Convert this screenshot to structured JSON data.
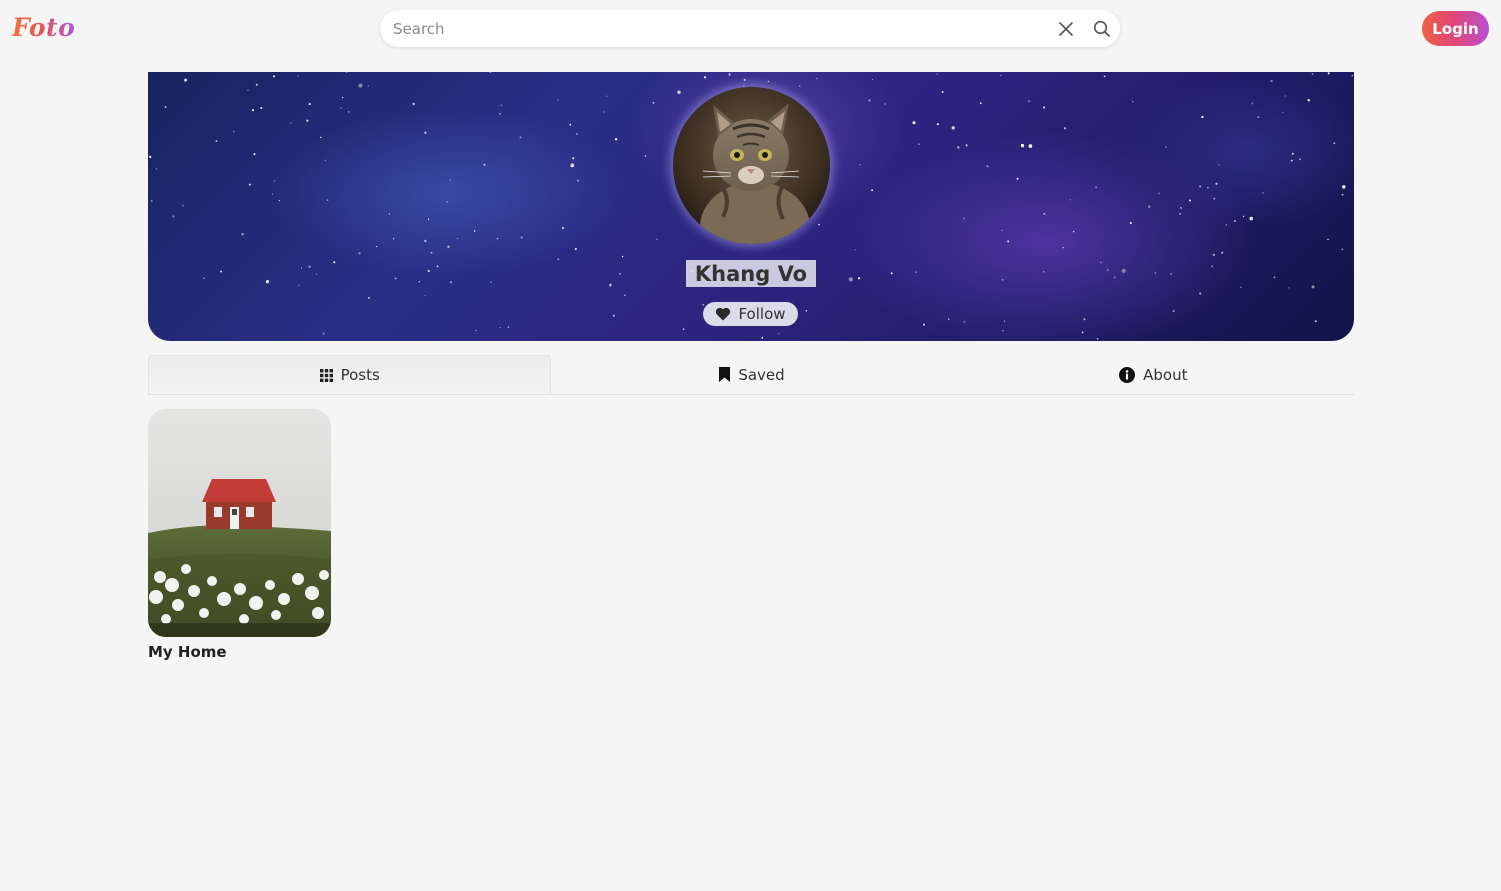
{
  "header": {
    "logo": "Foto",
    "search_placeholder": "Search",
    "search_value": "",
    "login_label": "Login"
  },
  "profile": {
    "name": "Khang Vo",
    "follow_label": "Follow"
  },
  "tabs": [
    {
      "label": "Posts",
      "icon": "grid-icon",
      "active": true
    },
    {
      "label": "Saved",
      "icon": "bookmark-icon",
      "active": false
    },
    {
      "label": "About",
      "icon": "info-icon",
      "active": false
    }
  ],
  "posts": [
    {
      "title": "My Home"
    }
  ],
  "colors": {
    "background": "#f5f5f5",
    "login_gradient_start": "#ee5f45",
    "login_gradient_end": "#b84fd2",
    "banner_dark": "#1d1b62"
  }
}
